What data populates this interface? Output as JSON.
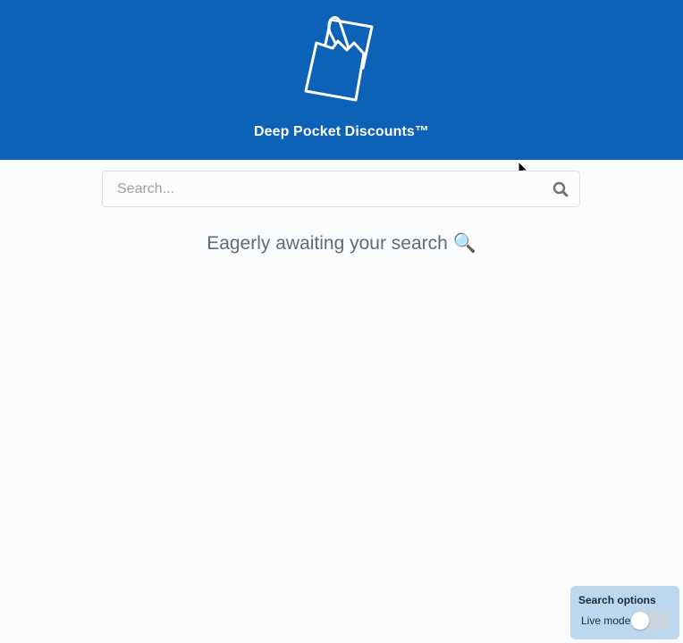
{
  "header": {
    "brand_title": "Deep Pocket Discounts™",
    "logo_icon": "grocery-bag-icon",
    "background_color": "#0b62b7"
  },
  "search": {
    "placeholder": "Search...",
    "value": "",
    "button_icon": "search-icon"
  },
  "main": {
    "empty_message": "Eagerly awaiting your search 🔍"
  },
  "options_panel": {
    "title": "Search options",
    "live_mode_label": "Live mode",
    "live_mode_enabled": false
  }
}
